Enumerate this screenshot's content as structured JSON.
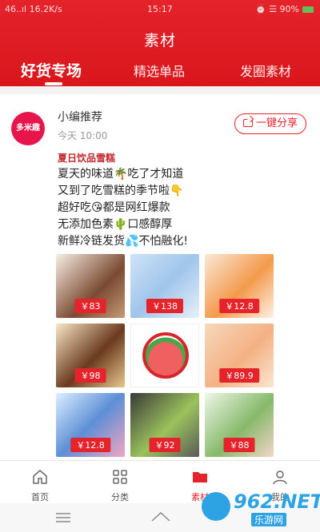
{
  "status_bar": {
    "left": "46..ıl 16.2K/s",
    "time": "15:17",
    "right": "⏰ ☰ 90%"
  },
  "header": {
    "title": "素材",
    "tabs": [
      {
        "label": "好货专场",
        "active": true
      },
      {
        "label": "精选单品",
        "active": false
      },
      {
        "label": "发圈素材",
        "active": false
      }
    ]
  },
  "post": {
    "avatar_text": "多米趣",
    "author": "小编推荐",
    "time": "今天 10:00",
    "share_label": "一键分享",
    "title": "夏日饮品雪糕",
    "lines": [
      "夏天的味道🌴吃了才知道",
      "又到了吃雪糕的季节啦👇",
      "超好吃😘都是网红爆款",
      "无添加色素🌵口感醇厚",
      "新鲜冷链发货💦不怕融化!"
    ],
    "products": [
      {
        "price": "￥83"
      },
      {
        "price": "￥138"
      },
      {
        "price": "￥12.8"
      },
      {
        "price": "￥98"
      },
      {
        "price": ""
      },
      {
        "price": "￥89.9"
      },
      {
        "price": "￥12.8"
      },
      {
        "price": "￥92"
      },
      {
        "price": "￥88"
      }
    ]
  },
  "bottom_nav": [
    {
      "label": "首页",
      "icon": "home-icon",
      "active": false
    },
    {
      "label": "分类",
      "icon": "grid-icon",
      "active": false
    },
    {
      "label": "素材",
      "icon": "folder-icon",
      "active": true
    },
    {
      "label": "我的",
      "icon": "user-icon",
      "active": false
    }
  ],
  "watermark": {
    "text": "962.NET",
    "sub": "乐游网"
  },
  "colors": {
    "brand_red": "#e4232b",
    "price_red": "#e4232b"
  }
}
